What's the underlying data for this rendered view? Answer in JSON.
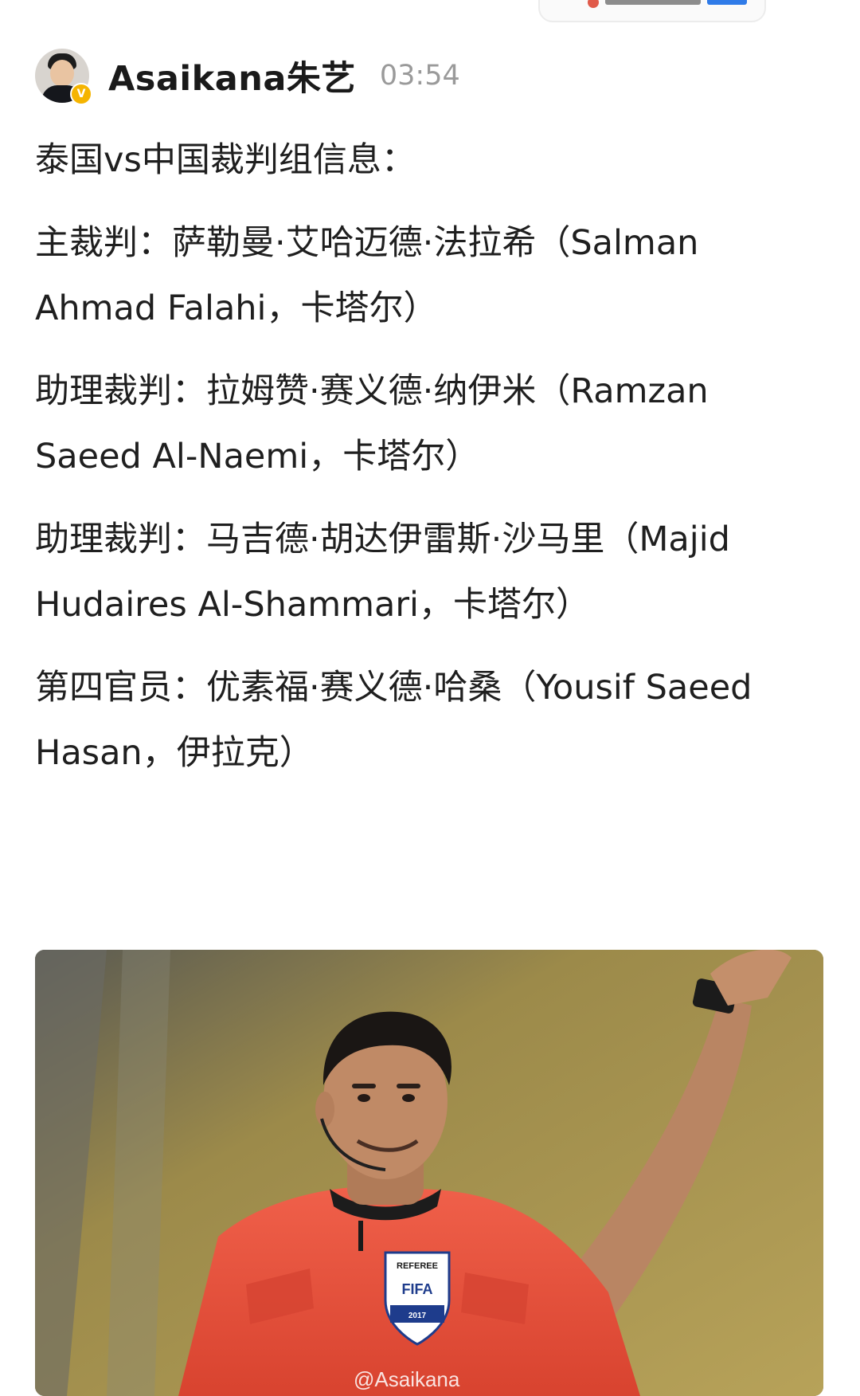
{
  "post": {
    "author": "Asaikana朱艺",
    "time": "03:54",
    "verified_icon": "v-badge-icon",
    "paragraphs": [
      "泰国vs中国裁判组信息：",
      "主裁判：萨勒曼·艾哈迈德·法拉希（Salman Ahmad Falahi，卡塔尔）",
      "助理裁判：拉姆赞·赛义德·纳伊米（Ramzan Saeed Al-Naemi，卡塔尔）",
      "助理裁判：马吉德·胡达伊雷斯·沙马里（Majid Hudaires Al-Shammari，卡塔尔）",
      "第四官员：优素福·赛义德·哈桑（Yousif Saeed Hasan，伊拉克）"
    ]
  },
  "photo": {
    "badge_top": "REFEREE",
    "badge_middle": "FIFA",
    "badge_year": "2017",
    "watermark": "@Asaikana",
    "colors": {
      "jersey": "#e8513d",
      "background": "#9c8a4a"
    }
  },
  "colors": {
    "text": "#1f1f1f",
    "muted": "#9a9a9a",
    "verified": "#f5b400"
  }
}
